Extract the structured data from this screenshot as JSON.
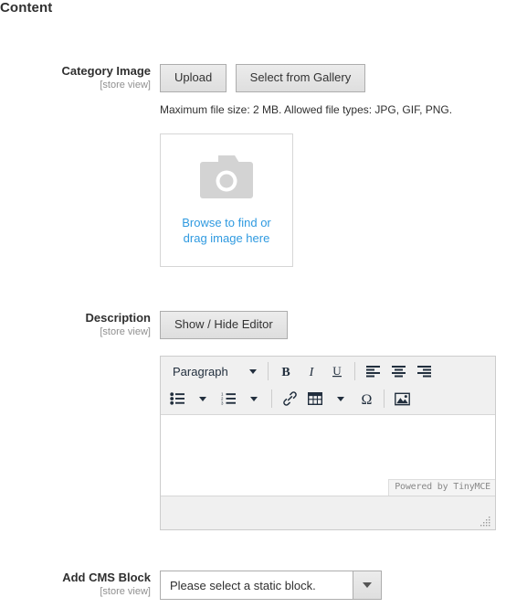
{
  "section": {
    "title": "Content"
  },
  "fields": {
    "category_image": {
      "label": "Category Image",
      "scope": "[store view]",
      "upload_label": "Upload",
      "gallery_label": "Select from Gallery",
      "note": "Maximum file size: 2 MB. Allowed file types: JPG, GIF, PNG.",
      "dropzone_line1": "Browse to find or",
      "dropzone_line2": "drag image here",
      "dropzone_icon": "camera-icon",
      "dropzone_text_color": "#2f9ae0"
    },
    "description": {
      "label": "Description",
      "scope": "[store view]",
      "toggle_label": "Show / Hide Editor",
      "editor": {
        "format_select_value": "Paragraph",
        "branding": "Powered by TinyMCE",
        "content": "",
        "toolbar_row1": [
          {
            "name": "bold-icon",
            "glyph": "B"
          },
          {
            "name": "italic-icon",
            "glyph": "I"
          },
          {
            "name": "underline-icon",
            "glyph": "U"
          },
          {
            "name": "align-left-icon",
            "glyph": ""
          },
          {
            "name": "align-center-icon",
            "glyph": ""
          },
          {
            "name": "align-right-icon",
            "glyph": ""
          }
        ],
        "toolbar_row2": [
          {
            "name": "bullet-list-icon",
            "glyph": ""
          },
          {
            "name": "numbered-list-icon",
            "glyph": ""
          },
          {
            "name": "link-icon",
            "glyph": ""
          },
          {
            "name": "table-icon",
            "glyph": ""
          },
          {
            "name": "special-character-icon",
            "glyph": "Ω"
          },
          {
            "name": "insert-image-icon",
            "glyph": ""
          }
        ]
      }
    },
    "cms_block": {
      "label": "Add CMS Block",
      "scope": "[store view]",
      "selected_option": "Please select a static block.",
      "options": [
        "Please select a static block."
      ]
    }
  },
  "colors": {
    "accent_link": "#2f9ae0",
    "text": "#303030",
    "muted": "#909090",
    "button_bg": "#e3e3e3",
    "button_border": "#adadad",
    "editor_chrome": "#f0f0f0"
  }
}
